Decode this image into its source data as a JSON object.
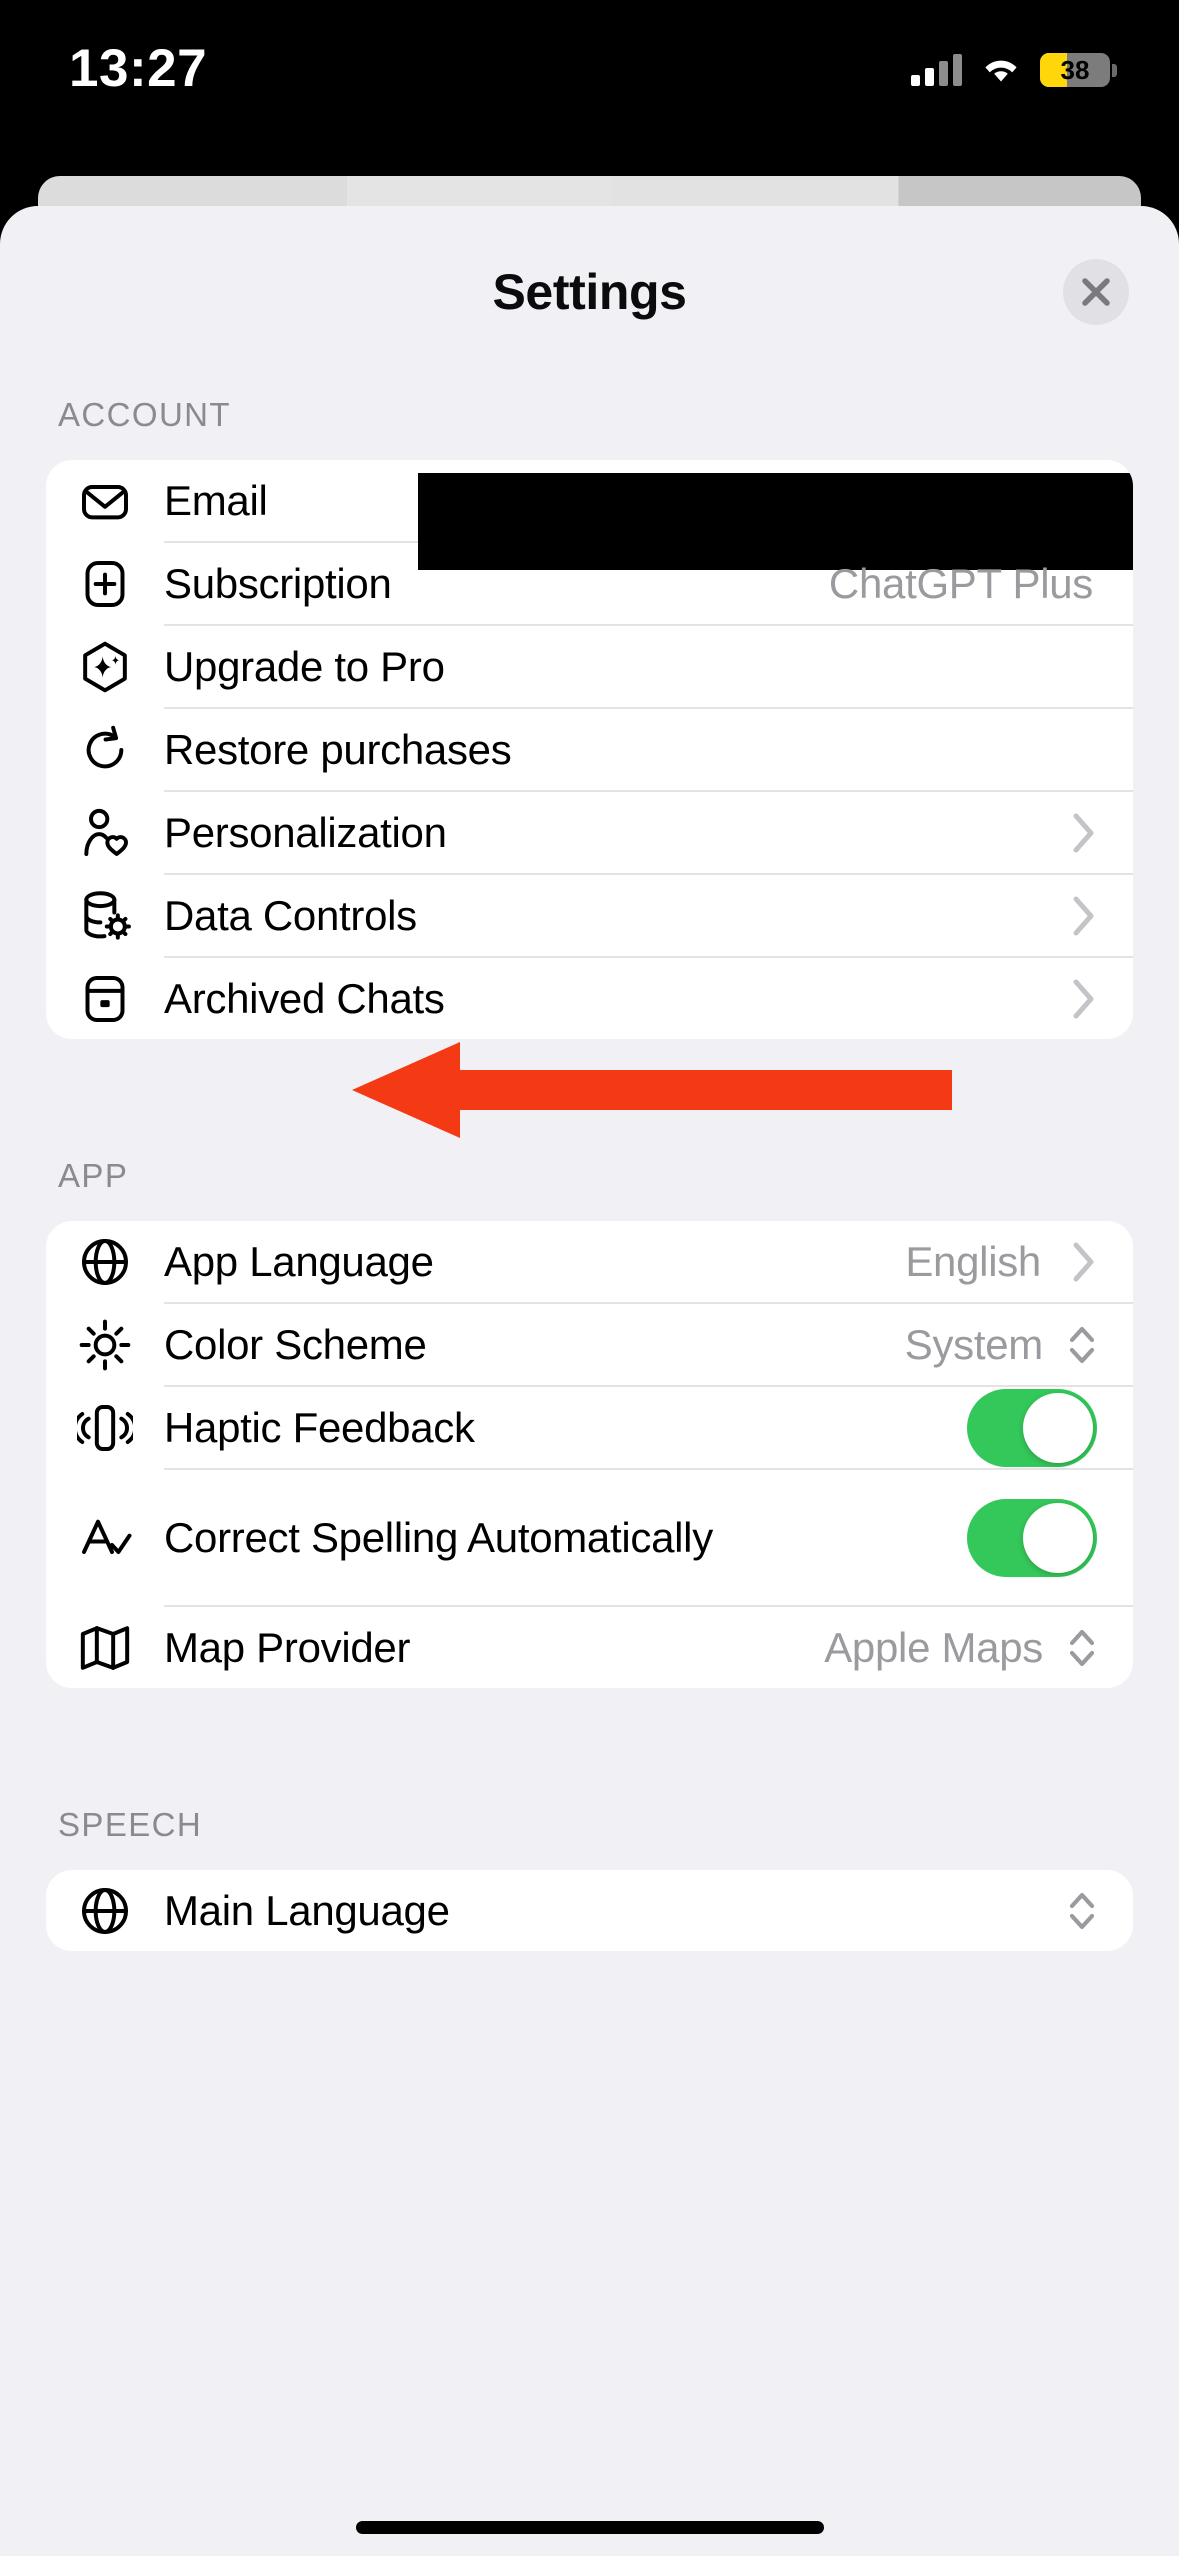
{
  "status_bar": {
    "time": "13:27",
    "battery_percent": "38",
    "battery_level_fraction": 0.38,
    "cellular_icon": "cellular-bars-icon",
    "wifi_icon": "wifi-icon",
    "low_power_color": "#ffd60a"
  },
  "sheet": {
    "title": "Settings",
    "close_label": "close-icon"
  },
  "sections": [
    {
      "label": "ACCOUNT",
      "rows": [
        {
          "icon": "envelope-icon",
          "label": "Email",
          "value": "",
          "accessory": "redacted"
        },
        {
          "icon": "plus-square-icon",
          "label": "Subscription",
          "value": "ChatGPT Plus",
          "accessory": "none"
        },
        {
          "icon": "hexagon-sparkle-icon",
          "label": "Upgrade to Pro",
          "value": "",
          "accessory": "none"
        },
        {
          "icon": "refresh-icon",
          "label": "Restore purchases",
          "value": "",
          "accessory": "none"
        },
        {
          "icon": "person-heart-icon",
          "label": "Personalization",
          "value": "",
          "accessory": "chevron"
        },
        {
          "icon": "database-gear-icon",
          "label": "Data Controls",
          "value": "",
          "accessory": "chevron"
        },
        {
          "icon": "archive-box-icon",
          "label": "Archived Chats",
          "value": "",
          "accessory": "chevron"
        }
      ]
    },
    {
      "label": "APP",
      "rows": [
        {
          "icon": "globe-icon",
          "label": "App Language",
          "value": "English",
          "accessory": "chevron"
        },
        {
          "icon": "sun-icon",
          "label": "Color Scheme",
          "value": "System",
          "accessory": "updown"
        },
        {
          "icon": "haptic-icon",
          "label": "Haptic Feedback",
          "value": "",
          "accessory": "toggle-on"
        },
        {
          "icon": "spellcheck-icon",
          "label": "Correct Spelling Automatically",
          "value": "",
          "accessory": "toggle-on"
        },
        {
          "icon": "map-icon",
          "label": "Map Provider",
          "value": "Apple Maps",
          "accessory": "updown"
        }
      ]
    },
    {
      "label": "SPEECH",
      "rows": [
        {
          "icon": "globe-icon",
          "label": "Main Language",
          "value": "",
          "accessory": "updown"
        }
      ]
    }
  ],
  "annotation": {
    "type": "arrow",
    "points_at": "Personalization",
    "color": "#f33a15"
  }
}
